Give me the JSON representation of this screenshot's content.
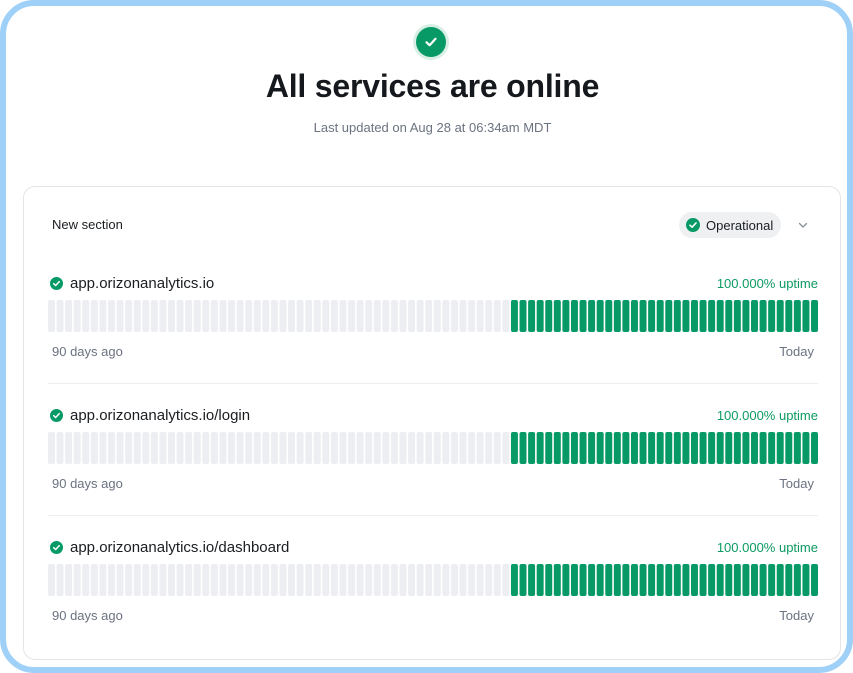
{
  "page": {
    "title": "All services are online",
    "last_updated": "Last updated on Aug 28 at 06:34am MDT"
  },
  "section": {
    "title": "New section",
    "status_label": "Operational"
  },
  "services": [
    {
      "name": "app.orizonanalytics.io",
      "uptime": "100.000% uptime",
      "start_label": "90 days ago",
      "end_label": "Today",
      "total_days": 90,
      "operational_days": 36
    },
    {
      "name": "app.orizonanalytics.io/login",
      "uptime": "100.000% uptime",
      "start_label": "90 days ago",
      "end_label": "Today",
      "total_days": 90,
      "operational_days": 36
    },
    {
      "name": "app.orizonanalytics.io/dashboard",
      "uptime": "100.000% uptime",
      "start_label": "90 days ago",
      "end_label": "Today",
      "total_days": 90,
      "operational_days": 36
    }
  ],
  "colors": {
    "operational": "#089a66",
    "no_data": "#eceef1",
    "accent_text": "#0c9a62"
  },
  "icons": {
    "header": "check-circle-icon",
    "status": "check-circle-icon",
    "expand": "chevron-down-icon"
  }
}
